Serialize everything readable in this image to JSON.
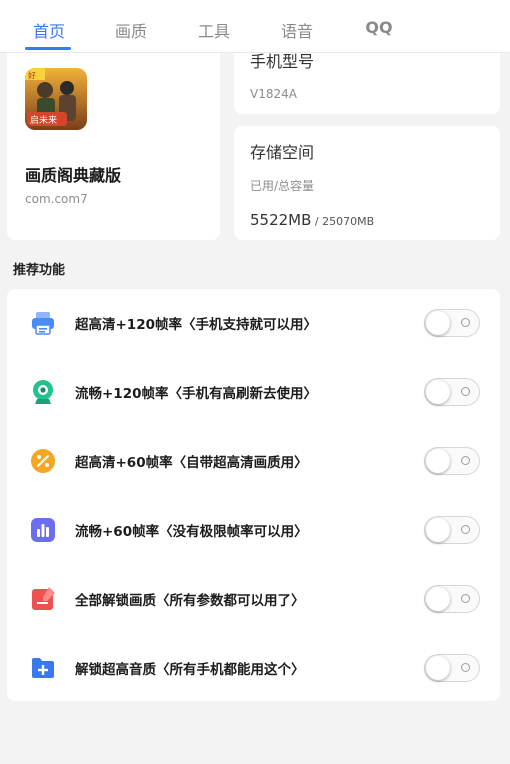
{
  "tabs": [
    {
      "label": "首页",
      "active": true
    },
    {
      "label": "画质",
      "active": false
    },
    {
      "label": "工具",
      "active": false
    },
    {
      "label": "语音",
      "active": false
    },
    {
      "label": "QQ",
      "active": false
    }
  ],
  "game": {
    "name": "画质阁典藏版",
    "package": "com.com7",
    "icon": "game-app-icon"
  },
  "phone": {
    "title": "手机型号",
    "model": "V1824A"
  },
  "storage": {
    "title": "存储空间",
    "subtitle": "已用/总容量",
    "used": "5522MB",
    "total": " / 25070MB"
  },
  "section_title": "推荐功能",
  "features": [
    {
      "label": "超高清+120帧率〈手机支持就可以用〉",
      "icon": "printer-icon",
      "color": "#4b8bf4",
      "enabled": false
    },
    {
      "label": "流畅+120帧率〈手机有高刷新去使用〉",
      "icon": "webcam-icon",
      "color": "#22c18e",
      "enabled": false
    },
    {
      "label": "超高清+60帧率〈自带超高清画质用〉",
      "icon": "percent-icon",
      "color": "#f5a623",
      "enabled": false
    },
    {
      "label": "流畅+60帧率〈没有极限帧率可以用〉",
      "icon": "bar-chart-icon",
      "color": "#6b6ef2",
      "enabled": false
    },
    {
      "label": "全部解锁画质〈所有参数都可以用了〉",
      "icon": "edit-icon",
      "color": "#f05050",
      "enabled": false
    },
    {
      "label": "解锁超高音质〈所有手机都能用这个〉",
      "icon": "folder-add-icon",
      "color": "#3a78f2",
      "enabled": false
    }
  ]
}
